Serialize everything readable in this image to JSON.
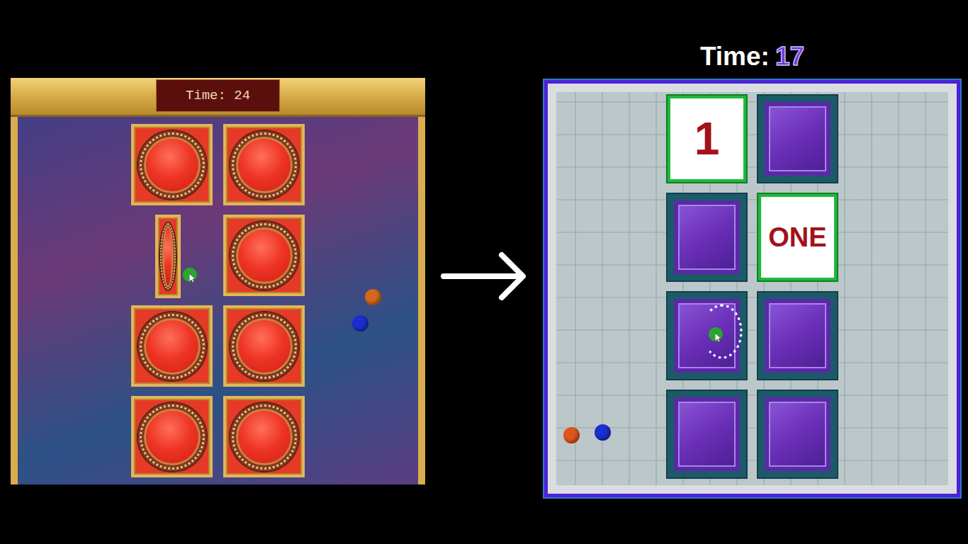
{
  "classic_board": {
    "timer": "Time: 24",
    "cards": [
      {
        "kind": "face-down"
      },
      {
        "kind": "face-down"
      },
      {
        "kind": "flipping"
      },
      {
        "kind": "face-down"
      },
      {
        "kind": "face-down"
      },
      {
        "kind": "face-down"
      },
      {
        "kind": "face-down"
      },
      {
        "kind": "face-down"
      }
    ],
    "markers": [
      {
        "kind": "cursor",
        "color": "#27a82c"
      },
      {
        "kind": "piece",
        "color": "#d4691c"
      },
      {
        "kind": "piece",
        "color": "#1a2fd0"
      }
    ]
  },
  "circuit_board": {
    "timer": {
      "label": "Time:",
      "value": "17"
    },
    "cards": [
      {
        "kind": "revealed",
        "text": "1",
        "matched": true,
        "hovered": false
      },
      {
        "kind": "hidden",
        "matched": false,
        "hovered": false
      },
      {
        "kind": "hidden",
        "matched": false,
        "hovered": false
      },
      {
        "kind": "revealed",
        "text": "ONE",
        "matched": true,
        "hovered": false
      },
      {
        "kind": "hidden",
        "matched": false,
        "hovered": true
      },
      {
        "kind": "hidden",
        "matched": false,
        "hovered": false
      },
      {
        "kind": "hidden",
        "matched": false,
        "hovered": false
      },
      {
        "kind": "hidden",
        "matched": false,
        "hovered": false
      }
    ],
    "markers": [
      {
        "kind": "cursor",
        "color": "#27a82c"
      },
      {
        "kind": "piece",
        "color": "#e0551c"
      },
      {
        "kind": "piece",
        "color": "#1a2fd0"
      }
    ]
  }
}
